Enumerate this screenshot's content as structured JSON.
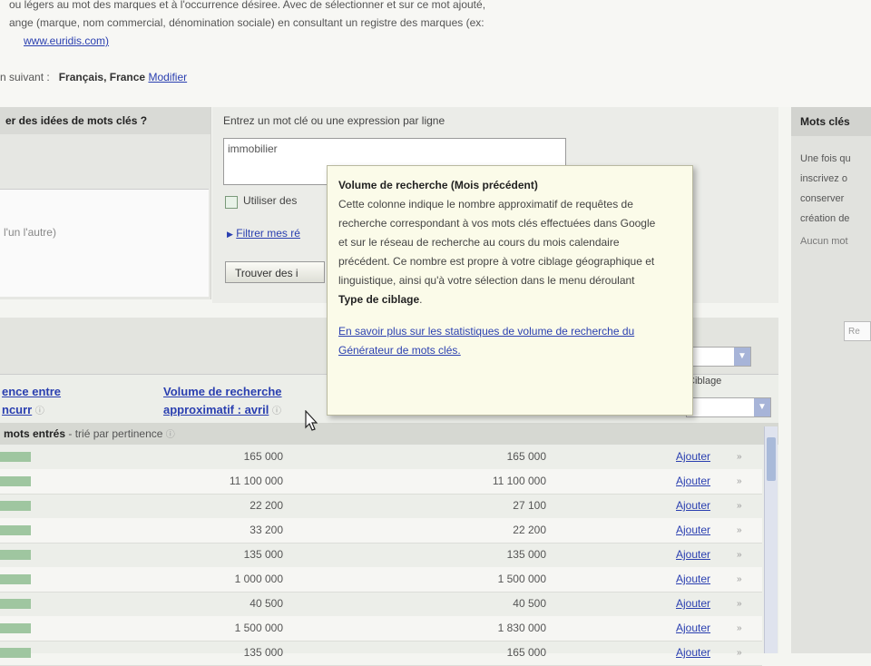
{
  "intro": {
    "line1": "ou légers au mot des marques et à l'occurrence désiree. Avec de sélectionner et sur ce mot ajouté,",
    "line2": "ange (marque, nom commercial, dénomination sociale) en consultant un registre des marques (ex:",
    "registry_link": "www.euridis.com)",
    "target_label": "n suivant :",
    "target_value": "Français, France",
    "modify_link": "Modifier"
  },
  "question": {
    "heading": "er des idées de mots clés ?",
    "box_text": "l'un l'autre)"
  },
  "entry": {
    "label": "Entrez un mot clé ou une expression par ligne",
    "keyword_value": "immobilier",
    "synonym_label": "Utiliser des",
    "filter_link": "Filtrer mes ré",
    "find_button": "Trouver des i"
  },
  "sidebar": {
    "heading": "Mots clés",
    "text": "Une fois qu inscrivez o conserver création de",
    "note": "Aucun mot",
    "search_placeholder": "Re"
  },
  "table": {
    "col1_line1": "ence entre",
    "col1_line2": "ncurr",
    "col2_line1": "Volume de recherche",
    "col2_line2": "approximatif : avril",
    "col_select": "Ciblage",
    "group_label": "mots entrés",
    "group_note": "- trié par pertinence",
    "add_label": "Ajouter",
    "rows": [
      {
        "v1": "165 000",
        "v2": "165 000"
      },
      {
        "v1": "11 100 000",
        "v2": "11 100 000"
      },
      {
        "v1": "22 200",
        "v2": "27 100"
      },
      {
        "v1": "33 200",
        "v2": "22 200"
      },
      {
        "v1": "135 000",
        "v2": "135 000"
      },
      {
        "v1": "1 000 000",
        "v2": "1 500 000"
      },
      {
        "v1": "40 500",
        "v2": "40 500"
      },
      {
        "v1": "1 500 000",
        "v2": "1 830 000"
      },
      {
        "v1": "135 000",
        "v2": "165 000"
      }
    ]
  },
  "tooltip": {
    "title": "Volume de recherche (Mois précédent)",
    "body_main": "Cette colonne indique le nombre approximatif de requêtes de recherche correspondant à vos mots clés effectuées dans Google et sur le réseau de recherche au cours du mois calendaire précédent. Ce nombre est propre à votre ciblage géographique et linguistique, ainsi qu'à votre sélection dans le menu déroulant",
    "body_bold": "Type de ciblage",
    "link": "En savoir plus sur les statistiques de volume de recherche du Générateur de mots clés."
  },
  "colors": {
    "link": "#2a3fb0",
    "tooltip_bg": "#fbfbe9",
    "bar": "#9fc6a0"
  }
}
